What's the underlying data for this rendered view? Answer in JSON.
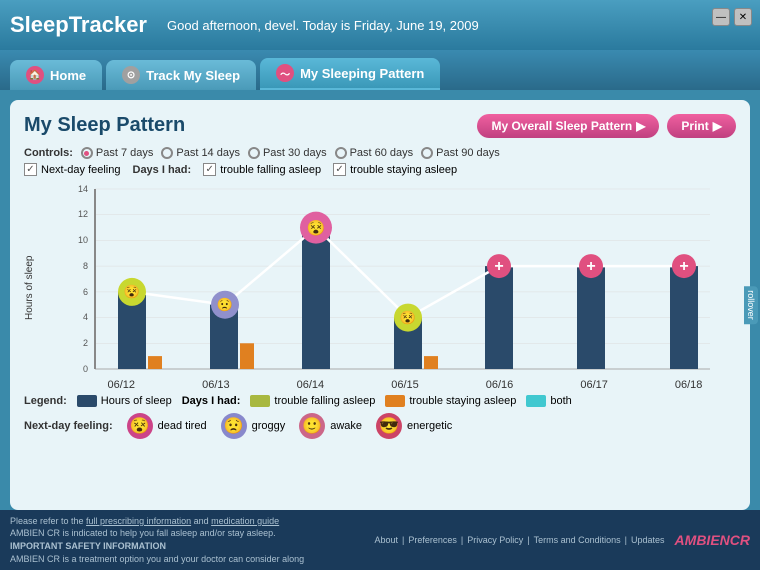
{
  "app": {
    "title": "SleepTracker",
    "greeting": "Good afternoon, devel. Today is Friday, June 19, 2009"
  },
  "window_controls": {
    "minimize": "—",
    "close": "✕"
  },
  "tabs": [
    {
      "id": "home",
      "label": "Home",
      "icon_type": "home",
      "active": false
    },
    {
      "id": "track",
      "label": "Track My Sleep",
      "icon_type": "track",
      "active": false
    },
    {
      "id": "pattern",
      "label": "My Sleeping Pattern",
      "icon_type": "pattern",
      "active": true
    }
  ],
  "panel": {
    "title": "My Sleep Pattern",
    "btn_overall": "My Overall Sleep Pattern",
    "btn_print": "Print"
  },
  "controls": {
    "label": "Controls:",
    "radios": [
      {
        "label": "Past 7 days",
        "selected": true
      },
      {
        "label": "Past 14 days",
        "selected": false
      },
      {
        "label": "Past 30 days",
        "selected": false
      },
      {
        "label": "Past 60 days",
        "selected": false
      },
      {
        "label": "Past 90 days",
        "selected": false
      }
    ],
    "checkboxes": [
      {
        "label": "Next-day feeling",
        "checked": true
      },
      {
        "label": "trouble falling asleep",
        "checked": true,
        "days_had_prefix": "Days I had:"
      },
      {
        "label": "trouble staying asleep",
        "checked": true
      }
    ]
  },
  "chart": {
    "y_label": "Hours of sleep",
    "y_max": 14,
    "y_ticks": [
      0,
      2,
      4,
      6,
      8,
      10,
      12,
      14
    ],
    "x_labels": [
      "06/12",
      "06/13",
      "06/14",
      "06/15",
      "06/16",
      "06/17",
      "06/18"
    ],
    "bars": [
      {
        "date": "06/12",
        "sleep": 6,
        "falling": 0,
        "staying": 1,
        "face": "tired",
        "face_h": 6
      },
      {
        "date": "06/13",
        "sleep": 5,
        "falling": 0,
        "staying": 2,
        "face": "sad",
        "face_h": 5
      },
      {
        "date": "06/14",
        "sleep": 11,
        "falling": 0,
        "staying": 0,
        "face": "excited",
        "face_h": 11
      },
      {
        "date": "06/15",
        "sleep": 4,
        "falling": 0,
        "staying": 1,
        "face": "tired2",
        "face_h": 4
      },
      {
        "date": "06/16",
        "sleep": 8,
        "falling": 0,
        "staying": 0,
        "face": "plus",
        "face_h": 8
      },
      {
        "date": "06/17",
        "sleep": 8,
        "falling": 0,
        "staying": 0,
        "face": "plus",
        "face_h": 8
      },
      {
        "date": "06/18",
        "sleep": 8,
        "falling": 0,
        "staying": 0,
        "face": "plus",
        "face_h": 8
      }
    ]
  },
  "legend": {
    "items": [
      {
        "label": "Hours of sleep",
        "color": "#2a4a6a"
      },
      {
        "label": "Days I had:",
        "bold": true
      },
      {
        "label": "trouble falling asleep",
        "color": "#a8b840"
      },
      {
        "label": "trouble staying asleep",
        "color": "#e08020"
      },
      {
        "label": "both",
        "color": "#40c8d0"
      }
    ]
  },
  "feelings": {
    "label": "Next-day feeling:",
    "items": [
      {
        "emoji": "😵",
        "label": "dead tired",
        "bg": "#cc4488"
      },
      {
        "emoji": "😟",
        "label": "groggy",
        "bg": "#8888cc"
      },
      {
        "emoji": "🙂",
        "label": "awake",
        "bg": "#cc6688"
      },
      {
        "emoji": "😎",
        "label": "energetic",
        "bg": "#cc4466"
      }
    ]
  },
  "bottom": {
    "safety_text": "Please refer to the ",
    "prescribing_link": "full prescribing information",
    "and_text": " and ",
    "med_guide_link": "medication guide",
    "line2": "AMBIEN CR is indicated to help you fall asleep and/or stay asleep.",
    "line3": "IMPORTANT SAFETY INFORMATION",
    "line4": "AMBIEN CR is a treatment option you and your doctor can consider along",
    "links": [
      "About",
      "Preferences",
      "Privacy Policy",
      "Terms and Conditions",
      "Updates"
    ],
    "logo": "AMBIENCR"
  }
}
